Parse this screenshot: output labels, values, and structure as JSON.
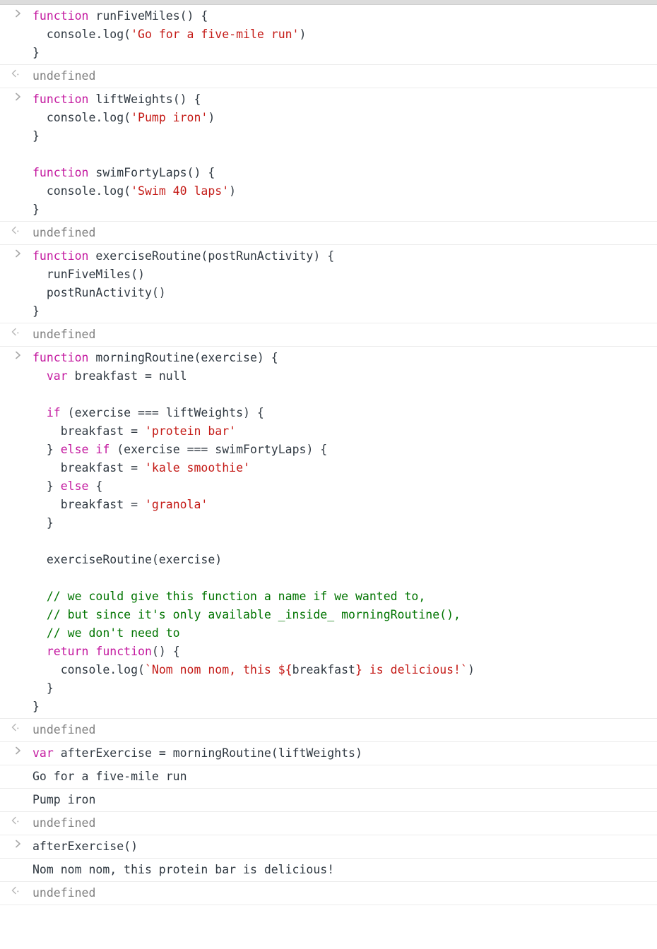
{
  "app": {
    "name": "Browser DevTools Console",
    "prompt_marker": "input-chevron-icon",
    "result_marker": "output-chevron-icon"
  },
  "colors": {
    "background": "#ffffff",
    "keyword": "#c41aa0",
    "string": "#c41a16",
    "comment": "#007400",
    "plain_text": "#303942",
    "result_gray": "#808080",
    "row_divider": "#ececec",
    "top_bar": "#dcdcdc",
    "marker_gray": "#a8a8a8"
  },
  "console": {
    "entries": [
      {
        "kind": "input",
        "marker": ">",
        "lines": [
          [
            {
              "t": "function",
              "c": "kw"
            },
            {
              "t": " runFiveMiles() {",
              "c": "txt"
            }
          ],
          [
            {
              "t": "  console.log(",
              "c": "txt"
            },
            {
              "t": "'Go for a five-mile run'",
              "c": "str"
            },
            {
              "t": ")",
              "c": "txt"
            }
          ],
          [
            {
              "t": "}",
              "c": "txt"
            }
          ]
        ]
      },
      {
        "kind": "result",
        "marker": "<",
        "lines": [
          [
            {
              "t": "undefined",
              "c": "res"
            }
          ]
        ]
      },
      {
        "kind": "input",
        "marker": ">",
        "lines": [
          [
            {
              "t": "function",
              "c": "kw"
            },
            {
              "t": " liftWeights() {",
              "c": "txt"
            }
          ],
          [
            {
              "t": "  console.log(",
              "c": "txt"
            },
            {
              "t": "'Pump iron'",
              "c": "str"
            },
            {
              "t": ")",
              "c": "txt"
            }
          ],
          [
            {
              "t": "}",
              "c": "txt"
            }
          ],
          [
            {
              "t": "",
              "c": "txt"
            }
          ],
          [
            {
              "t": "function",
              "c": "kw"
            },
            {
              "t": " swimFortyLaps() {",
              "c": "txt"
            }
          ],
          [
            {
              "t": "  console.log(",
              "c": "txt"
            },
            {
              "t": "'Swim 40 laps'",
              "c": "str"
            },
            {
              "t": ")",
              "c": "txt"
            }
          ],
          [
            {
              "t": "}",
              "c": "txt"
            }
          ]
        ]
      },
      {
        "kind": "result",
        "marker": "<",
        "lines": [
          [
            {
              "t": "undefined",
              "c": "res"
            }
          ]
        ]
      },
      {
        "kind": "input",
        "marker": ">",
        "lines": [
          [
            {
              "t": "function",
              "c": "kw"
            },
            {
              "t": " exerciseRoutine(postRunActivity) {",
              "c": "txt"
            }
          ],
          [
            {
              "t": "  runFiveMiles()",
              "c": "txt"
            }
          ],
          [
            {
              "t": "  postRunActivity()",
              "c": "txt"
            }
          ],
          [
            {
              "t": "}",
              "c": "txt"
            }
          ]
        ]
      },
      {
        "kind": "result",
        "marker": "<",
        "lines": [
          [
            {
              "t": "undefined",
              "c": "res"
            }
          ]
        ]
      },
      {
        "kind": "input",
        "marker": ">",
        "lines": [
          [
            {
              "t": "function",
              "c": "kw"
            },
            {
              "t": " morningRoutine(exercise) {",
              "c": "txt"
            }
          ],
          [
            {
              "t": "  ",
              "c": "txt"
            },
            {
              "t": "var",
              "c": "kw"
            },
            {
              "t": " breakfast = null",
              "c": "txt"
            }
          ],
          [
            {
              "t": "",
              "c": "txt"
            }
          ],
          [
            {
              "t": "  ",
              "c": "txt"
            },
            {
              "t": "if",
              "c": "kw"
            },
            {
              "t": " (exercise === liftWeights) {",
              "c": "txt"
            }
          ],
          [
            {
              "t": "    breakfast = ",
              "c": "txt"
            },
            {
              "t": "'protein bar'",
              "c": "str"
            }
          ],
          [
            {
              "t": "  } ",
              "c": "txt"
            },
            {
              "t": "else if",
              "c": "kw"
            },
            {
              "t": " (exercise === swimFortyLaps) {",
              "c": "txt"
            }
          ],
          [
            {
              "t": "    breakfast = ",
              "c": "txt"
            },
            {
              "t": "'kale smoothie'",
              "c": "str"
            }
          ],
          [
            {
              "t": "  } ",
              "c": "txt"
            },
            {
              "t": "else",
              "c": "kw"
            },
            {
              "t": " {",
              "c": "txt"
            }
          ],
          [
            {
              "t": "    breakfast = ",
              "c": "txt"
            },
            {
              "t": "'granola'",
              "c": "str"
            }
          ],
          [
            {
              "t": "  }",
              "c": "txt"
            }
          ],
          [
            {
              "t": "",
              "c": "txt"
            }
          ],
          [
            {
              "t": "  exerciseRoutine(exercise)",
              "c": "txt"
            }
          ],
          [
            {
              "t": "",
              "c": "txt"
            }
          ],
          [
            {
              "t": "  // we could give this function a name if we wanted to,",
              "c": "cmt"
            }
          ],
          [
            {
              "t": "  // but since it's only available _inside_ morningRoutine(),",
              "c": "cmt"
            }
          ],
          [
            {
              "t": "  // we don't need to",
              "c": "cmt"
            }
          ],
          [
            {
              "t": "  ",
              "c": "txt"
            },
            {
              "t": "return function",
              "c": "kw"
            },
            {
              "t": "() {",
              "c": "txt"
            }
          ],
          [
            {
              "t": "    console.log(",
              "c": "txt"
            },
            {
              "t": "`Nom nom nom, this ${",
              "c": "str"
            },
            {
              "t": "breakfast",
              "c": "txt"
            },
            {
              "t": "} is delicious!`",
              "c": "str"
            },
            {
              "t": ")",
              "c": "txt"
            }
          ],
          [
            {
              "t": "  }",
              "c": "txt"
            }
          ],
          [
            {
              "t": "}",
              "c": "txt"
            }
          ]
        ]
      },
      {
        "kind": "result",
        "marker": "<",
        "lines": [
          [
            {
              "t": "undefined",
              "c": "res"
            }
          ]
        ]
      },
      {
        "kind": "input",
        "marker": ">",
        "lines": [
          [
            {
              "t": "var",
              "c": "kw"
            },
            {
              "t": " afterExercise = morningRoutine(liftWeights)",
              "c": "txt"
            }
          ]
        ]
      },
      {
        "kind": "log",
        "marker": "",
        "lines": [
          [
            {
              "t": "Go for a five-mile run",
              "c": "out"
            }
          ]
        ]
      },
      {
        "kind": "log",
        "marker": "",
        "lines": [
          [
            {
              "t": "Pump iron",
              "c": "out"
            }
          ]
        ]
      },
      {
        "kind": "result",
        "marker": "<",
        "lines": [
          [
            {
              "t": "undefined",
              "c": "res"
            }
          ]
        ]
      },
      {
        "kind": "input",
        "marker": ">",
        "lines": [
          [
            {
              "t": "afterExercise()",
              "c": "txt"
            }
          ]
        ]
      },
      {
        "kind": "log",
        "marker": "",
        "lines": [
          [
            {
              "t": "Nom nom nom, this protein bar is delicious!",
              "c": "out"
            }
          ]
        ]
      },
      {
        "kind": "result",
        "marker": "<",
        "lines": [
          [
            {
              "t": "undefined",
              "c": "res"
            }
          ]
        ]
      }
    ]
  }
}
